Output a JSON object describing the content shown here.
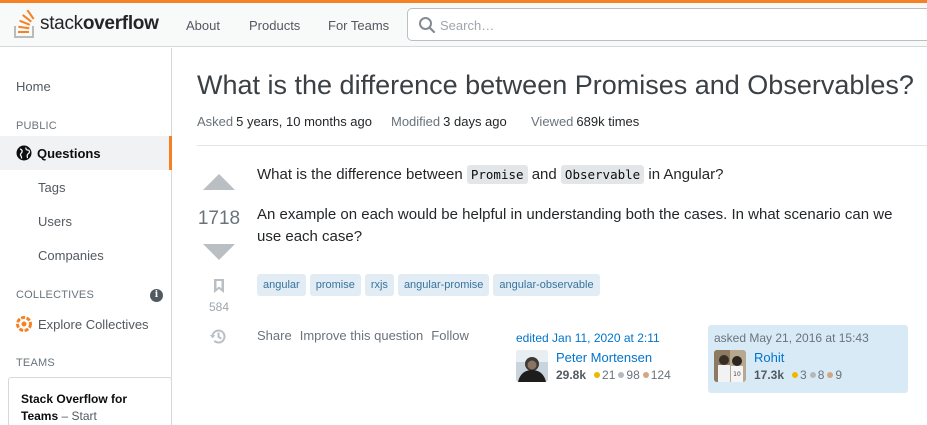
{
  "header": {
    "logo_text_light": "stack",
    "logo_text_bold": "overflow",
    "nav": [
      "About",
      "Products",
      "For Teams"
    ],
    "search_placeholder": "Search…"
  },
  "sidebar": {
    "home": "Home",
    "public_heading": "PUBLIC",
    "questions": "Questions",
    "tags": "Tags",
    "users": "Users",
    "companies": "Companies",
    "collectives_heading": "COLLECTIVES",
    "explore_collectives": "Explore Collectives",
    "teams_heading": "TEAMS",
    "teams_box_bold": "Stack Overflow for Teams",
    "teams_box_rest": " – Start"
  },
  "question": {
    "title": "What is the difference between Promises and Observables?",
    "meta": [
      {
        "key": "Asked",
        "value": "5 years, 10 months ago"
      },
      {
        "key": "Modified",
        "value": "3 days ago"
      },
      {
        "key": "Viewed",
        "value": "689k times"
      }
    ],
    "votes": "1718",
    "bookmarks": "584",
    "body_p1_a": "What is the difference between ",
    "body_p1_code1": "Promise",
    "body_p1_b": " and ",
    "body_p1_code2": "Observable",
    "body_p1_c": " in Angular?",
    "body_p2": "An example on each would be helpful in understanding both the cases. In what scenario can we use each case?",
    "tags": [
      "angular",
      "promise",
      "rxjs",
      "angular-promise",
      "angular-observable"
    ],
    "actions": [
      "Share",
      "Improve this question",
      "Follow"
    ]
  },
  "edited": {
    "label": "edited Jan 11, 2020 at 2:11",
    "user": "Peter Mortensen",
    "rep": "29.8k",
    "gold": "21",
    "silver": "98",
    "bronze": "124"
  },
  "asked": {
    "label": "asked May 21, 2016 at 15:43",
    "user": "Rohit",
    "rep": "17.3k",
    "gold": "3",
    "silver": "8",
    "bronze": "9"
  },
  "colors": {
    "accent": "#f48225",
    "link": "#0074cc",
    "tag_bg": "#e1ecf4",
    "tag_text": "#39739d",
    "asker_card_bg": "#d9eaf7"
  }
}
